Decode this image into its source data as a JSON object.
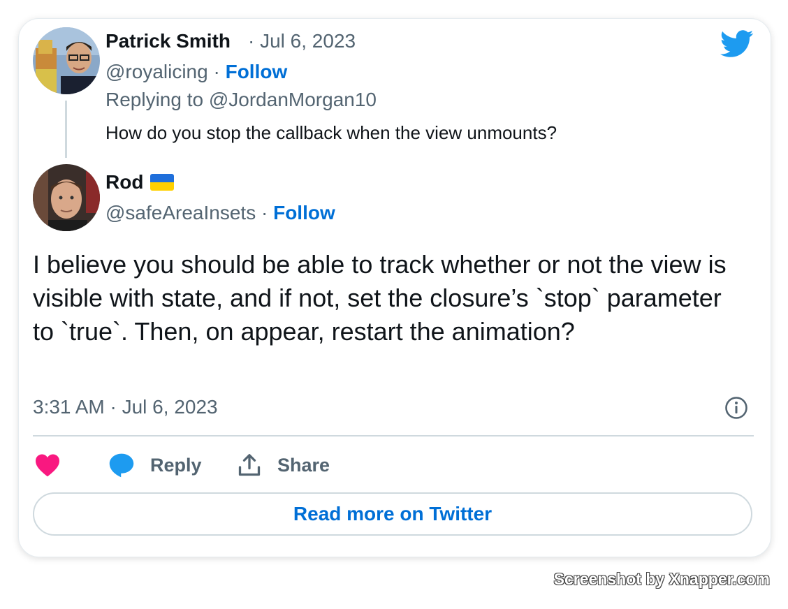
{
  "parent_tweet": {
    "author_name": "Patrick Smith",
    "separator_date": "· Jul 6, 2023",
    "handle": "@royalicing",
    "follow_separator": "·",
    "follow_label": "Follow",
    "replying_to": "Replying to @JordanMorgan10",
    "text": "How do you stop the callback when the view unmounts?"
  },
  "main_tweet": {
    "author_name": "Rod",
    "flag": "ukraine-flag",
    "handle": "@safeAreaInsets",
    "follow_separator": "·",
    "follow_label": "Follow",
    "text": "I believe you should be able to track whether or not the view is visible with state, and if not, set the closure’s `stop` parameter to `true`. Then, on appear, restart the animation?",
    "timestamp": "3:31 AM · Jul 6, 2023"
  },
  "actions": {
    "like_icon": "heart-icon",
    "reply_label": "Reply",
    "share_label": "Share"
  },
  "read_more_label": "Read more on Twitter",
  "watermark": "Screenshot by Xnapper.com",
  "colors": {
    "link_blue": "#006fd6",
    "twitter_blue": "#1d9bf0",
    "heart_pink": "#f91880",
    "muted_gray": "#536471"
  }
}
